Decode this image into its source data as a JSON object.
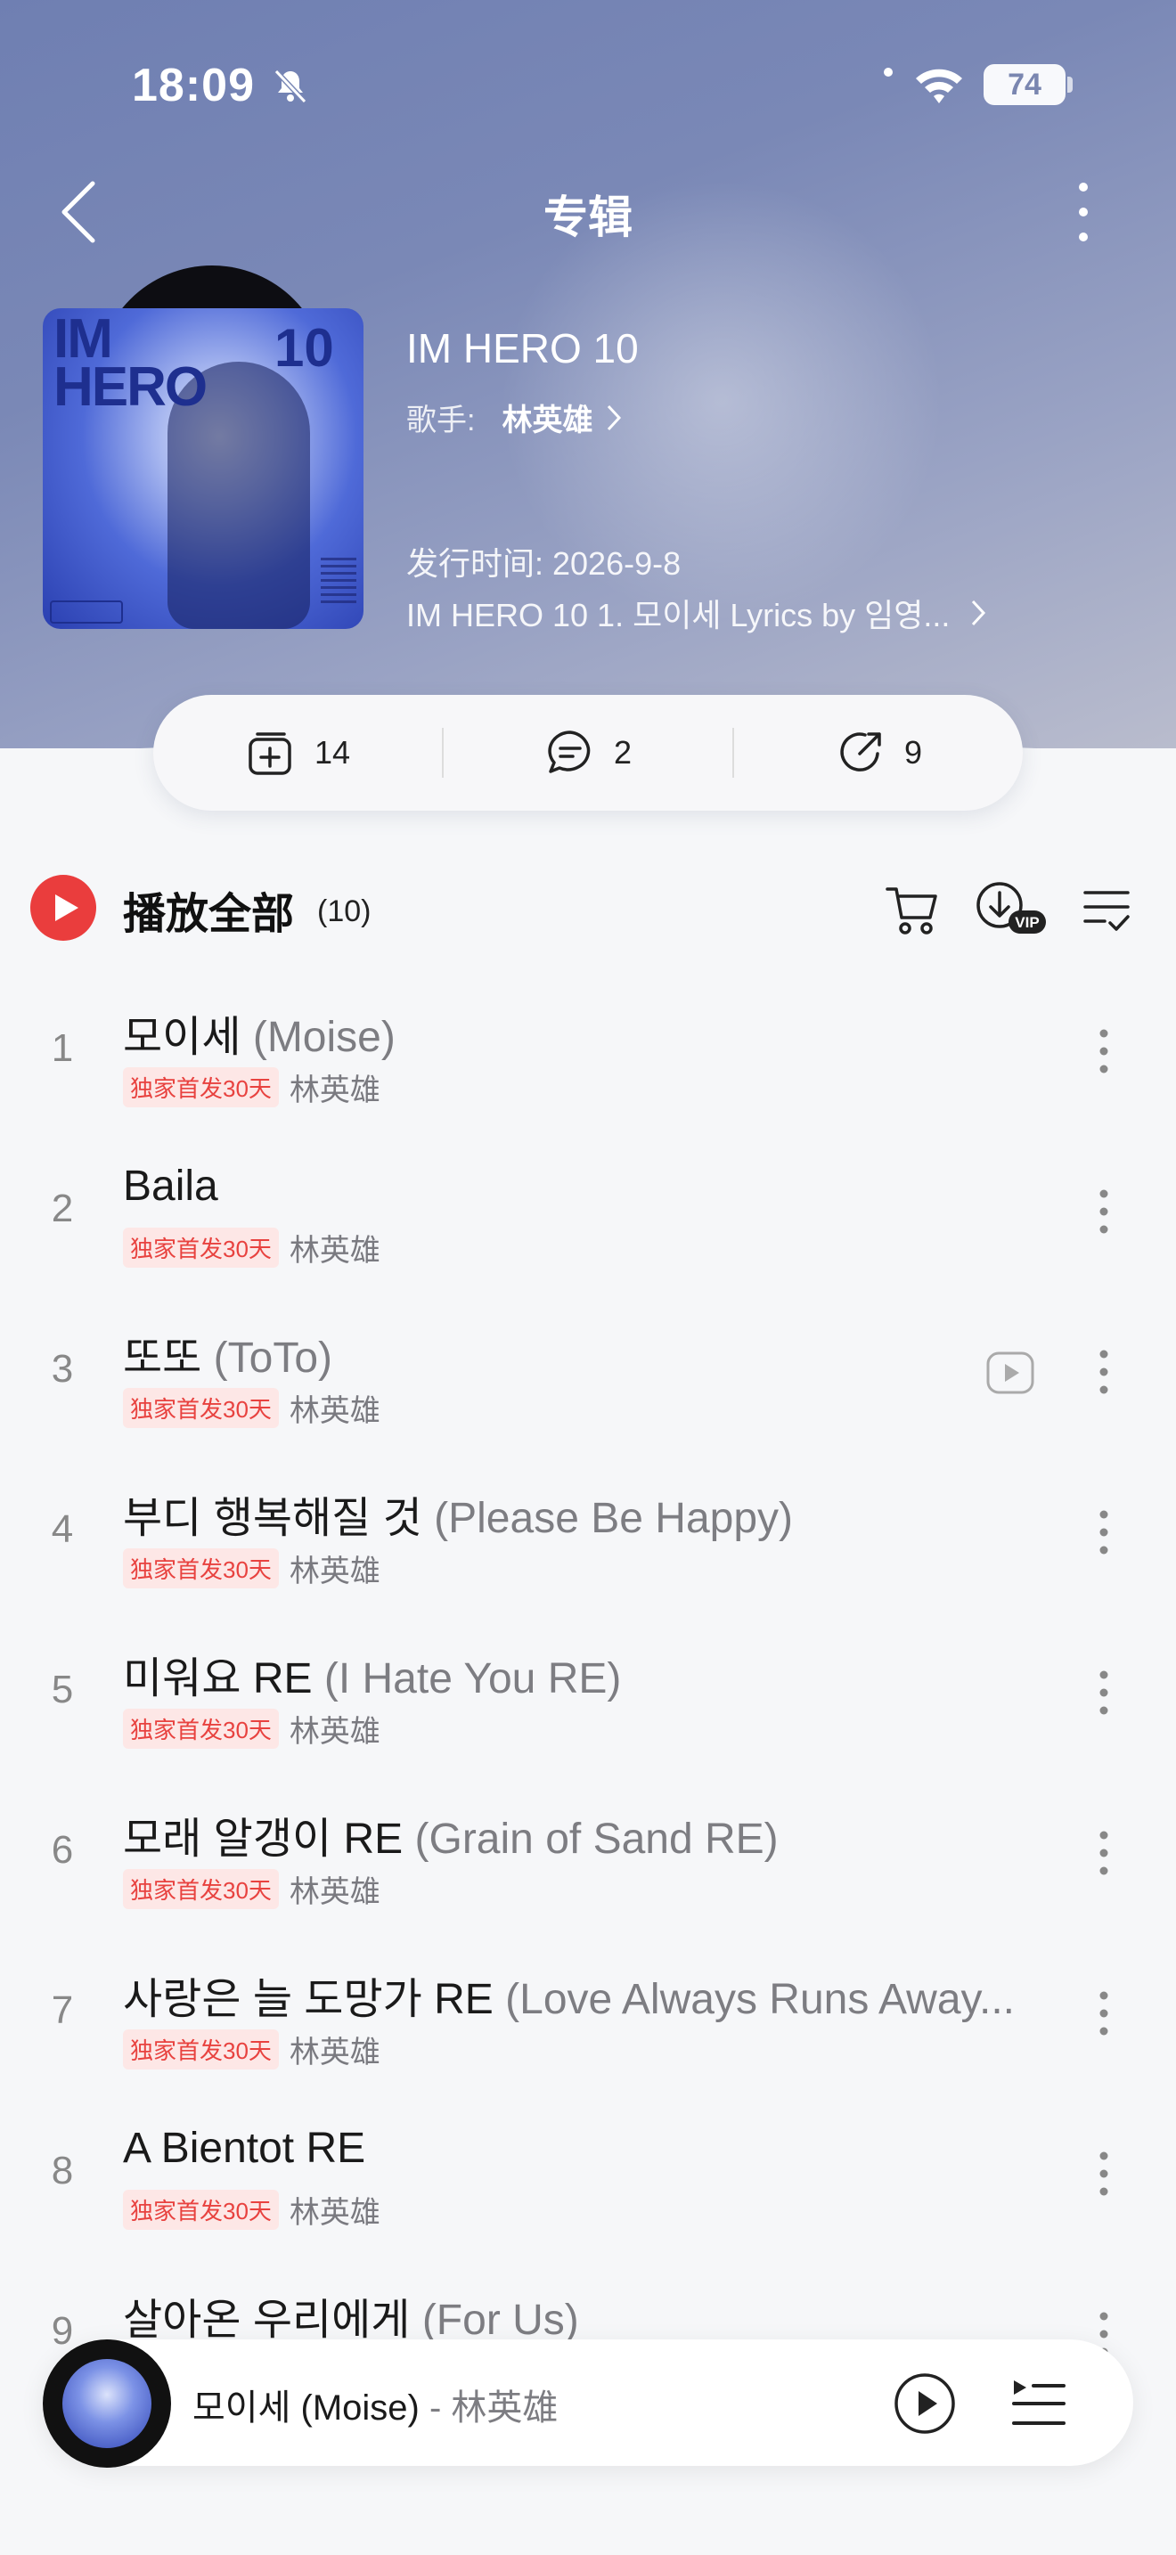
{
  "status": {
    "time": "18:09",
    "battery": "74"
  },
  "nav": {
    "title": "专辑"
  },
  "album": {
    "title": "IM HERO 10",
    "artist_label": "歌手:",
    "artist_name": "林英雄",
    "release": "发行时间: 2026-9-8",
    "description": "IM HERO 10 1. 모이세 Lyrics by 임영..."
  },
  "actions": {
    "collect_count": "14",
    "comment_count": "2",
    "share_count": "9"
  },
  "playall": {
    "label": "播放全部",
    "count": "(10)"
  },
  "songs": [
    {
      "num": "1",
      "title": "모이세",
      "sub": "(Moise)",
      "tag": "独家首发30天",
      "artist": "林英雄",
      "mv": false
    },
    {
      "num": "2",
      "title": "Baila",
      "sub": "",
      "tag": "独家首发30天",
      "artist": "林英雄",
      "mv": false
    },
    {
      "num": "3",
      "title": "또또",
      "sub": "(ToTo)",
      "tag": "独家首发30天",
      "artist": "林英雄",
      "mv": true
    },
    {
      "num": "4",
      "title": "부디 행복해질 것",
      "sub": "(Please Be Happy)",
      "tag": "独家首发30天",
      "artist": "林英雄",
      "mv": false
    },
    {
      "num": "5",
      "title": "미워요 RE",
      "sub": "(I Hate You RE)",
      "tag": "独家首发30天",
      "artist": "林英雄",
      "mv": false
    },
    {
      "num": "6",
      "title": "모래 알갱이 RE",
      "sub": "(Grain of Sand RE)",
      "tag": "独家首发30天",
      "artist": "林英雄",
      "mv": false
    },
    {
      "num": "7",
      "title": "사랑은 늘 도망가 RE",
      "sub": "(Love Always Runs Away...",
      "tag": "独家首发30天",
      "artist": "林英雄",
      "mv": false
    },
    {
      "num": "8",
      "title": "A Bientot RE",
      "sub": "",
      "tag": "独家首发30天",
      "artist": "林英雄",
      "mv": false
    },
    {
      "num": "9",
      "title": "살아온 우리에게",
      "sub": "(For Us)",
      "tag": "",
      "artist": "",
      "mv": false
    }
  ],
  "mini_player": {
    "title": "모이세 (Moise)",
    "separator": " - ",
    "artist": "林英雄"
  },
  "colors": {
    "accent": "#ea3d3d",
    "tag_text": "#e8423f",
    "tag_bg": "#fde7e6"
  }
}
